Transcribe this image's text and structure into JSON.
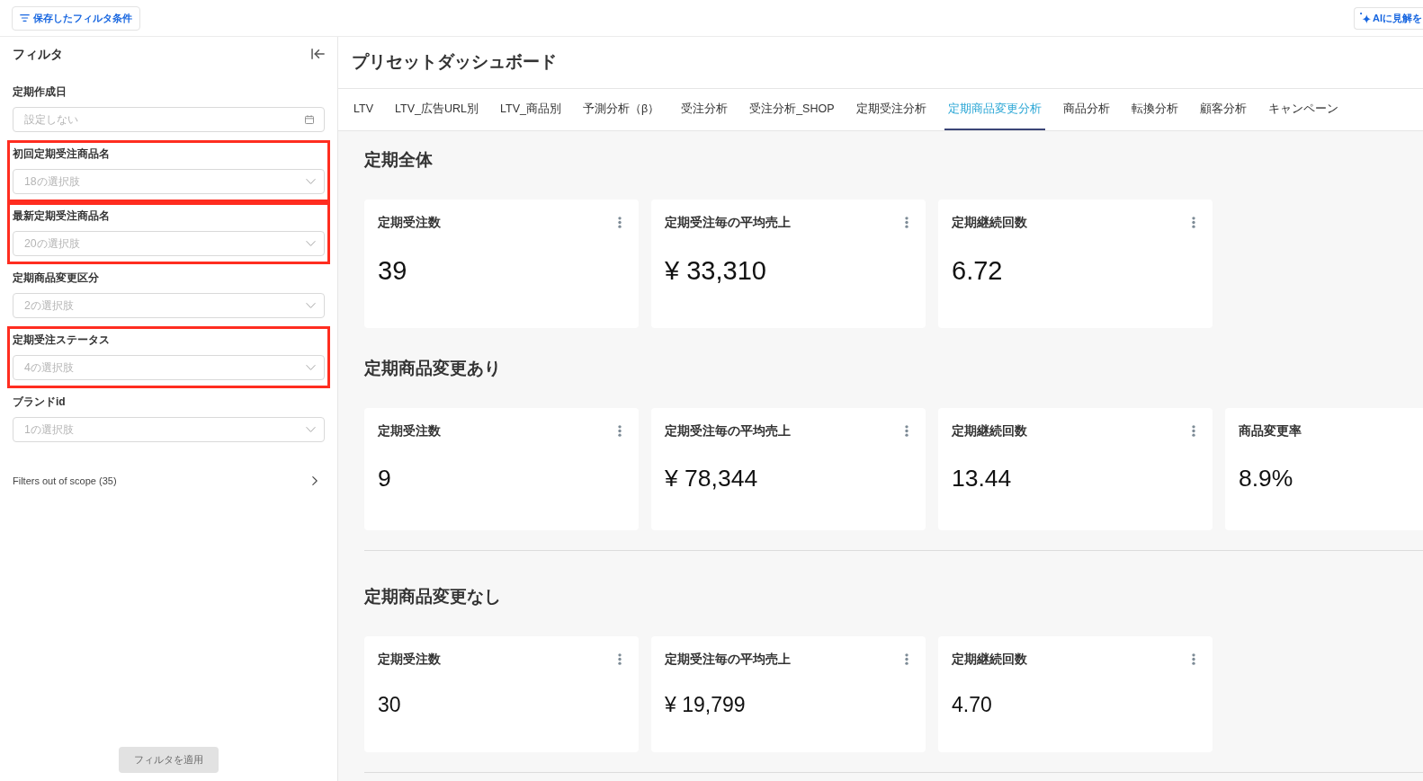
{
  "toolbar": {
    "saved_filters_button": "保存したフィルタ条件",
    "ai_button": "AIに見解を"
  },
  "filter_panel": {
    "title": "フィルタ",
    "filters": [
      {
        "kind": "date",
        "label": "定期作成日",
        "placeholder": "設定しない",
        "highlighted": false
      },
      {
        "kind": "select",
        "label": "初回定期受注商品名",
        "placeholder": "18の選択肢",
        "highlighted": true
      },
      {
        "kind": "select",
        "label": "最新定期受注商品名",
        "placeholder": "20の選択肢",
        "highlighted": true
      },
      {
        "kind": "select",
        "label": "定期商品変更区分",
        "placeholder": "2の選択肢",
        "highlighted": false
      },
      {
        "kind": "select",
        "label": "定期受注ステータス",
        "placeholder": "4の選択肢",
        "highlighted": true
      },
      {
        "kind": "select",
        "label": "ブランドid",
        "placeholder": "1の選択肢",
        "highlighted": false
      }
    ],
    "out_of_scope": "Filters out of scope (35)",
    "apply_button": {
      "label": "フィルタを適用",
      "disabled": true
    }
  },
  "dashboard": {
    "title": "プリセットダッシュボード",
    "tabs": [
      {
        "label": "LTV",
        "selected": false
      },
      {
        "label": "LTV_広告URL別",
        "selected": false
      },
      {
        "label": "LTV_商品別",
        "selected": false
      },
      {
        "label": "予測分析（β）",
        "selected": false
      },
      {
        "label": "受注分析",
        "selected": false
      },
      {
        "label": "受注分析_SHOP",
        "selected": false
      },
      {
        "label": "定期受注分析",
        "selected": false
      },
      {
        "label": "定期商品変更分析",
        "selected": true
      },
      {
        "label": "商品分析",
        "selected": false
      },
      {
        "label": "転換分析",
        "selected": false
      },
      {
        "label": "顧客分析",
        "selected": false
      },
      {
        "label": "キャンペーン",
        "selected": false
      }
    ],
    "sections": [
      {
        "title": "定期全体",
        "cards": [
          {
            "title": "定期受注数",
            "value": "39"
          },
          {
            "title": "定期受注毎の平均売上",
            "value": "¥ 33,310"
          },
          {
            "title": "定期継続回数",
            "value": "6.72"
          }
        ]
      },
      {
        "title": "定期商品変更あり",
        "cards": [
          {
            "title": "定期受注数",
            "value": "9"
          },
          {
            "title": "定期受注毎の平均売上",
            "value": "¥ 78,344"
          },
          {
            "title": "定期継続回数",
            "value": "13.44"
          },
          {
            "title": "商品変更率",
            "value": "8.9%"
          }
        ]
      },
      {
        "title": "定期商品変更なし",
        "cards": [
          {
            "title": "定期受注数",
            "value": "30"
          },
          {
            "title": "定期受注毎の平均売上",
            "value": "¥ 19,799"
          },
          {
            "title": "定期継続回数",
            "value": "4.70"
          }
        ]
      }
    ]
  }
}
